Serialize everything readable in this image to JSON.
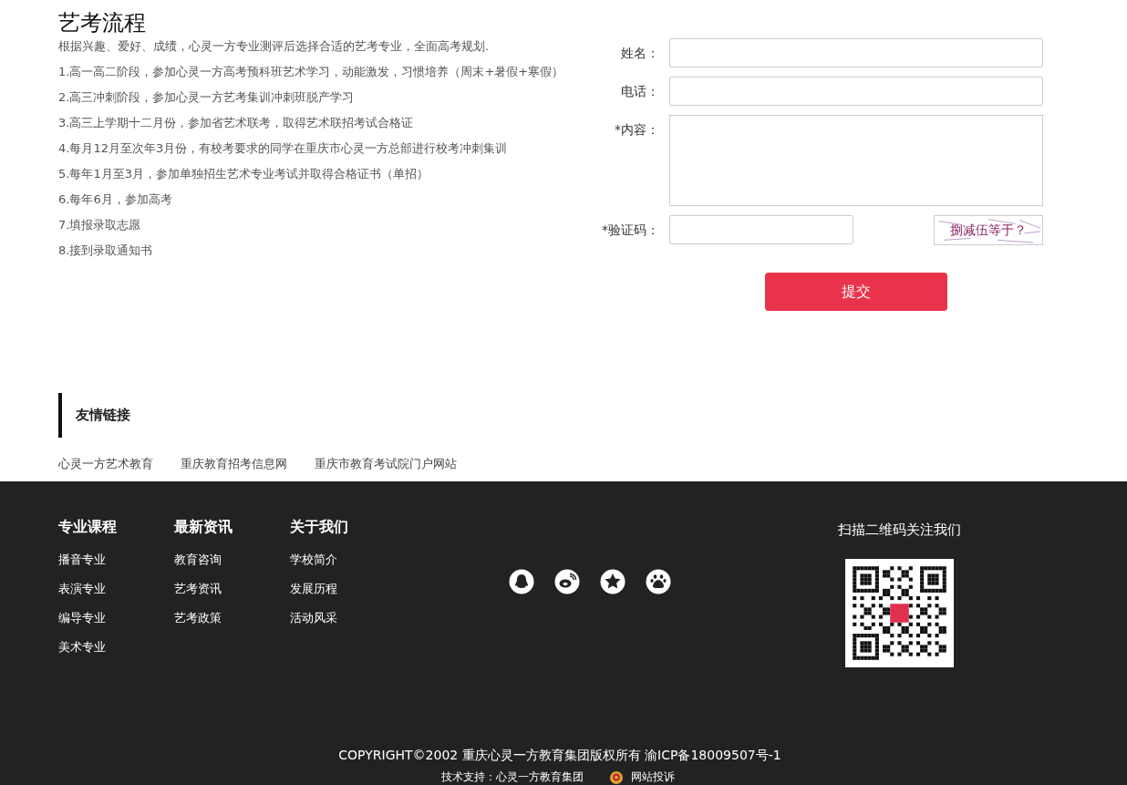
{
  "process": {
    "title": "艺考流程",
    "intro": "根据兴趣、爱好、成绩，心灵一方专业测评后选择合适的艺考专业，全面高考规划.",
    "steps": [
      "1.高一高二阶段，参加心灵一方高考预科班艺术学习，动能激发，习惯培养（周末+暑假+寒假）",
      "2.高三冲刺阶段，参加心灵一方艺考集训冲刺班脱产学习",
      "3.高三上学期十二月份，参加省艺术联考，取得艺术联招考试合格证",
      "4.每月12月至次年3月份，有校考要求的同学在重庆市心灵一方总部进行校考冲刺集训",
      "5.每年1月至3月，参加单独招生艺术专业考试并取得合格证书（单招）",
      "6.每年6月，参加高考",
      "7.填报录取志愿",
      "8.接到录取通知书"
    ]
  },
  "form": {
    "fields": [
      {
        "kind": "input",
        "label": "姓名："
      },
      {
        "kind": "input",
        "label": "电话："
      },
      {
        "kind": "textarea",
        "label": "*内容："
      },
      {
        "kind": "captcha",
        "label": "*验证码：",
        "captcha": "捌减伍等于？"
      }
    ],
    "submit": "提交"
  },
  "friend_links": {
    "title": "友情链接",
    "links": [
      "心灵一方艺术教育",
      "重庆教育招考信息网",
      "重庆市教育考试院门户网站"
    ]
  },
  "footer": {
    "columns": [
      {
        "title": "专业课程",
        "items": [
          "播音专业",
          "表演专业",
          "编导专业",
          "美术专业"
        ]
      },
      {
        "title": "最新资讯",
        "items": [
          "教育咨询",
          "艺考资讯",
          "艺考政策"
        ]
      },
      {
        "title": "关于我们",
        "items": [
          "学校简介",
          "发展历程",
          "活动风采"
        ]
      }
    ],
    "social": [
      {
        "kind": "penguin"
      },
      {
        "kind": "swirl"
      },
      {
        "kind": "star"
      },
      {
        "kind": "paw"
      }
    ],
    "qr_title": "扫描二维码关注我们",
    "copyright": "COPYRIGHT©2002 重庆心灵一方教育集团版权所有 渝ICP备18009507号-1",
    "support": "技术支持：心灵一方教育集团",
    "complaint": "网站投诉"
  }
}
